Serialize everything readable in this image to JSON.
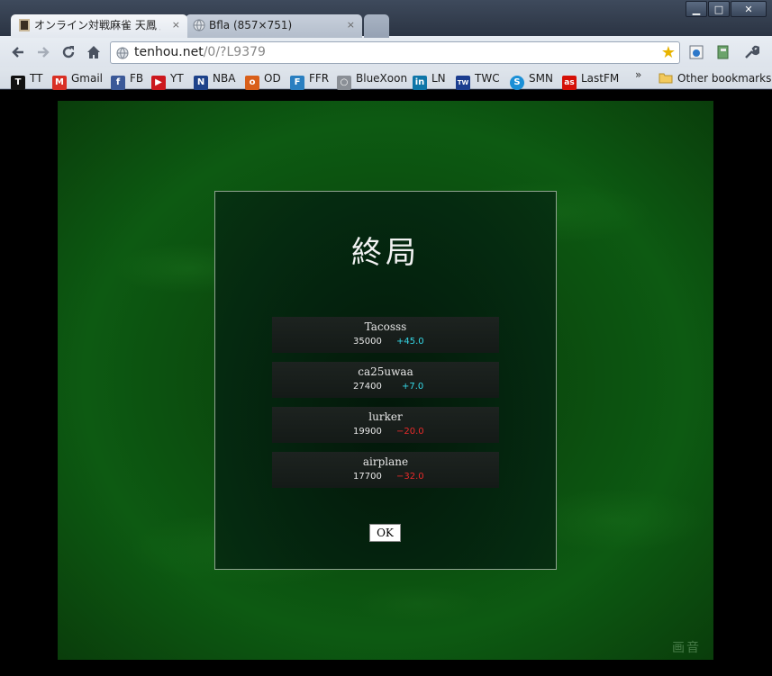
{
  "window": {
    "tabs": [
      {
        "title": "オンライン対戦麻雀 天鳳 /",
        "close": "×"
      },
      {
        "title": "Bfla (857×751)",
        "close": "×"
      }
    ],
    "controls": {
      "minimize": "▁",
      "maximize": "□",
      "close": "✕"
    }
  },
  "toolbar": {
    "url_host": "tenhou.net",
    "url_path": "/0/?L9379"
  },
  "bookmarks": {
    "items": [
      {
        "label": "TT",
        "icon": "tt-icon",
        "color": "#111111",
        "glyph": "T"
      },
      {
        "label": "Gmail",
        "icon": "gmail-icon",
        "color": "#d93025",
        "glyph": "M"
      },
      {
        "label": "FB",
        "icon": "facebook-icon",
        "color": "#3b5998",
        "glyph": "f"
      },
      {
        "label": "YT",
        "icon": "youtube-icon",
        "color": "#cc181e",
        "glyph": "▶"
      },
      {
        "label": "NBA",
        "icon": "nba-icon",
        "color": "#1d428a",
        "glyph": "N"
      },
      {
        "label": "OD",
        "icon": "od-icon",
        "color": "#d95f1a",
        "glyph": "o"
      },
      {
        "label": "FFR",
        "icon": "ffr-icon",
        "color": "#2a7fc0",
        "glyph": "F"
      },
      {
        "label": "BlueXoon",
        "icon": "globe-icon",
        "color": "#8a8f96",
        "glyph": "○"
      },
      {
        "label": "LN",
        "icon": "linkedin-icon",
        "color": "#0e76a8",
        "glyph": "in"
      },
      {
        "label": "TWC",
        "icon": "twc-icon",
        "color": "#1b3d8f",
        "glyph": "TW"
      },
      {
        "label": "SMN",
        "icon": "smn-icon",
        "color": "#1a8fd6",
        "glyph": "S"
      },
      {
        "label": "LastFM",
        "icon": "lastfm-icon",
        "color": "#d51007",
        "glyph": "as"
      }
    ],
    "more": "»",
    "other": "Other bookmarks"
  },
  "dialog": {
    "title": "終局",
    "players": [
      {
        "name": "Tacosss",
        "score": "35000",
        "delta": "+45.0",
        "sign": "pos"
      },
      {
        "name": "ca25uwaa",
        "score": "27400",
        "delta": "+7.0",
        "sign": "pos"
      },
      {
        "name": "lurker",
        "score": "19900",
        "delta": "−20.0",
        "sign": "neg"
      },
      {
        "name": "airplane",
        "score": "17700",
        "delta": "−32.0",
        "sign": "neg"
      }
    ],
    "ok_label": "OK"
  },
  "watermark": "画音"
}
